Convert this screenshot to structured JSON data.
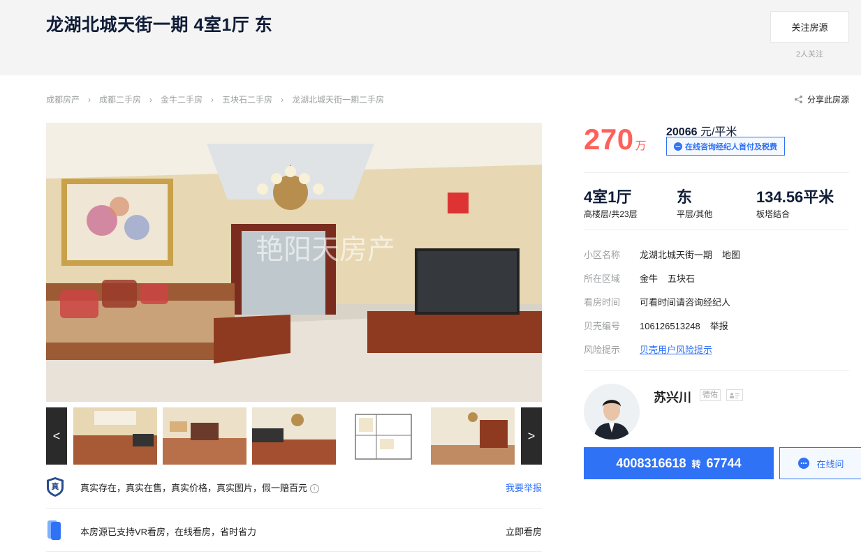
{
  "header": {
    "title": "龙湖北城天街一期 4室1厅 东",
    "follow_label": "关注房源",
    "follow_count": "2人关注"
  },
  "breadcrumb": {
    "items": [
      "成都房产",
      "成都二手房",
      "金牛二手房",
      "五块石二手房",
      "龙湖北城天街一期二手房"
    ],
    "share_label": "分享此房源"
  },
  "gallery": {
    "watermark": "艳阳天房产",
    "prev_label": "<",
    "next_label": ">",
    "thumbnails": [
      "living-room",
      "living-room-2",
      "living-room-3",
      "floor-plan",
      "dining-room"
    ]
  },
  "trust": {
    "badge": "真",
    "text": "真实存在，真实在售，真实价格，真实图片，假一赔百元",
    "action": "我要举报"
  },
  "vr": {
    "text": "本房源已支持VR看房，在线看房，省时省力",
    "action": "立即看房"
  },
  "price": {
    "total": "270",
    "total_unit": "万",
    "unit_value": "20066",
    "unit_suffix": " 元/平米",
    "consult_label": "在线咨询经纪人首付及税费"
  },
  "attributes": [
    {
      "main": "4室1厅",
      "sub": "高楼层/共23层"
    },
    {
      "main": "东",
      "sub": "平层/其他"
    },
    {
      "main": "134.56平米",
      "sub": "板塔结合"
    }
  ],
  "info": {
    "community_label": "小区名称",
    "community": "龙湖北城天街一期",
    "map_label": "地图",
    "area_label": "所在区域",
    "area_district": "金牛",
    "area_sub": "五块石",
    "visit_label": "看房时间",
    "visit": "可看时间请咨询经纪人",
    "id_label": "贝壳编号",
    "id": "106126513248",
    "report_label": "举报",
    "risk_label": "风险提示",
    "risk_link": "贝壳用户风险提示"
  },
  "agent": {
    "name": "苏兴川",
    "company": "德佑",
    "phone": "4008316618",
    "phone_sep": "转",
    "ext": "67744",
    "online_label": "在线问"
  },
  "colors": {
    "accent": "#3072f6",
    "price": "#fe615a",
    "title": "#101d37",
    "muted": "#9c9fa1"
  }
}
